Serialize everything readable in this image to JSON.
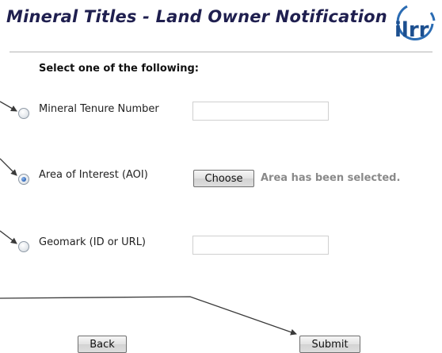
{
  "header": {
    "title": "Mineral Titles - Land Owner Notification",
    "logo_text": "ilrr"
  },
  "form": {
    "prompt": "Select one of the following:",
    "options": [
      {
        "label": "Mineral Tenure Number",
        "selected": false
      },
      {
        "label": "Area of Interest (AOI)",
        "selected": true
      },
      {
        "label": "Geomark (ID or URL)",
        "selected": false
      }
    ],
    "tenure_input": {
      "value": "",
      "placeholder": ""
    },
    "geomark_input": {
      "value": "",
      "placeholder": ""
    },
    "choose_label": "Choose",
    "aoi_status": "Area has been selected."
  },
  "footer": {
    "back_label": "Back",
    "submit_label": "Submit"
  },
  "colors": {
    "title": "#1f1f4f",
    "status": "#8a8a8a",
    "radio_selected": "#2e66b8",
    "arrow": "#3a3a3a"
  }
}
